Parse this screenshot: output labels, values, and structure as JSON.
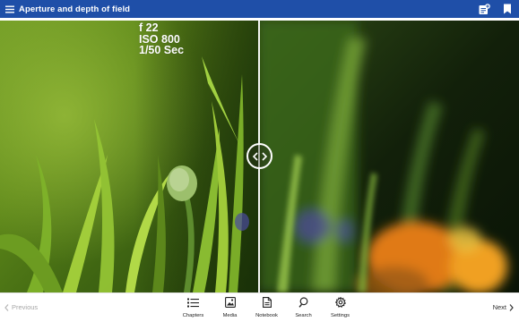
{
  "header": {
    "title": "Aperture and depth of field",
    "menu_icon": "hamburger-menu-icon",
    "actions": [
      {
        "name": "add-note-icon"
      },
      {
        "name": "bookmark-icon"
      }
    ],
    "background": "#1f4fa8"
  },
  "viewer": {
    "exif": {
      "aperture": "f 22",
      "iso": "ISO 800",
      "shutter": "1/50 Sec"
    },
    "comparison_handle_icon": "chevron-left-right-icon"
  },
  "footer": {
    "previous_label": "Previous",
    "next_label": "Next",
    "tools": [
      {
        "label": "Chapters",
        "icon": "chapters-list-icon"
      },
      {
        "label": "Media",
        "icon": "media-image-icon"
      },
      {
        "label": "Notebook",
        "icon": "notebook-icon"
      },
      {
        "label": "Search",
        "icon": "search-icon"
      },
      {
        "label": "Settings",
        "icon": "settings-gear-icon"
      }
    ]
  }
}
